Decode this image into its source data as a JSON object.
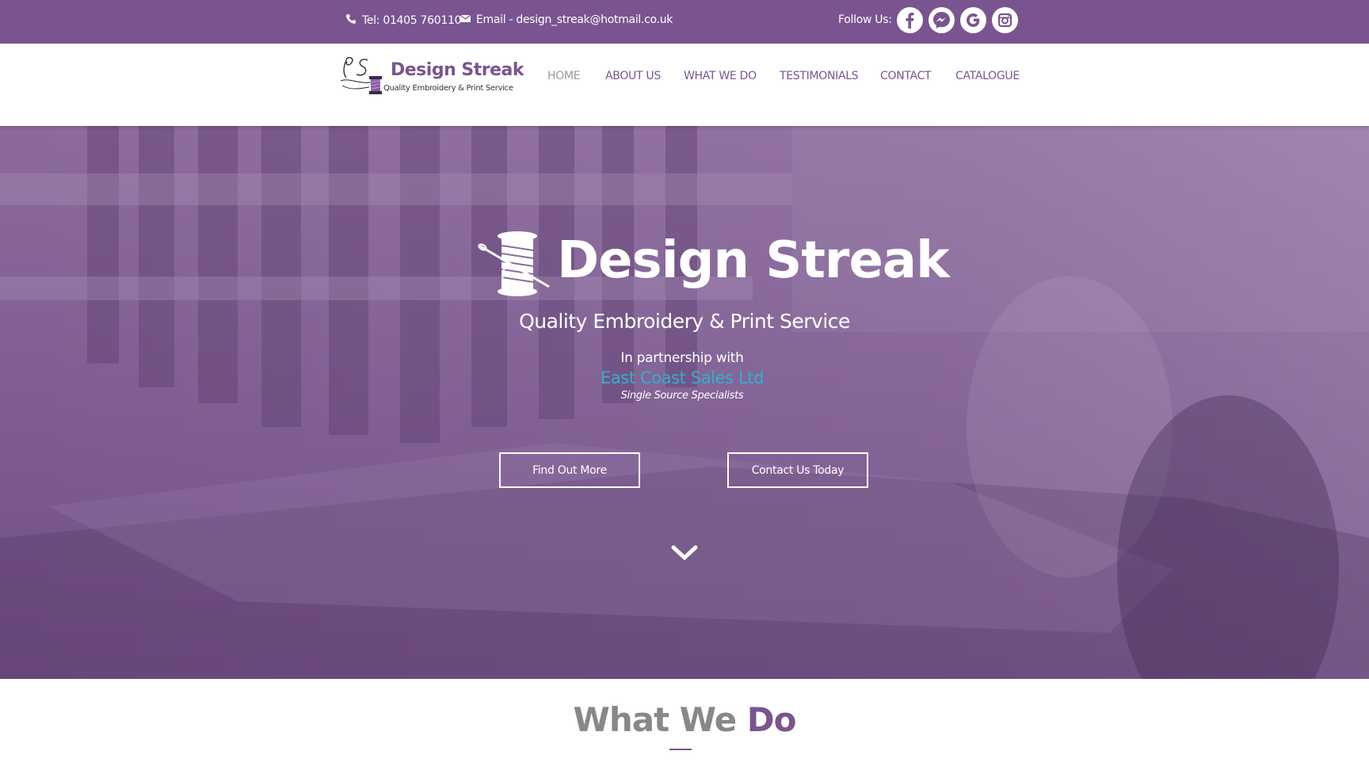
{
  "topbar": {
    "phone": "Tel: 01405 760110",
    "email": "Email - design_streak@hotmail.co.uk",
    "follow_label": "Follow Us:",
    "social": [
      "facebook-icon",
      "messenger-icon",
      "google-icon",
      "instagram-icon"
    ]
  },
  "header": {
    "logo_title": "Design Streak",
    "logo_subtitle": "Quality Embroidery & Print Service",
    "nav": [
      "HOME",
      "ABOUT US",
      "WHAT WE DO",
      "TESTIMONIALS",
      "CONTACT",
      "CATALOGUE"
    ],
    "active_nav": "HOME"
  },
  "hero": {
    "title": "Design Streak",
    "subtitle": "Quality Embroidery & Print Service",
    "partner_intro": "In partnership with",
    "partner_name": "East Coast Sales Ltd",
    "partner_tagline": "Single Source Specialists",
    "btn_find": "Find Out More",
    "btn_contact": "Contact Us Today"
  },
  "section": {
    "title_part1": "What We",
    "title_part2": "Do"
  },
  "colors": {
    "brand_purple": "#7a5490",
    "accent_teal": "#2fb2c9",
    "muted_grey": "#888888"
  }
}
